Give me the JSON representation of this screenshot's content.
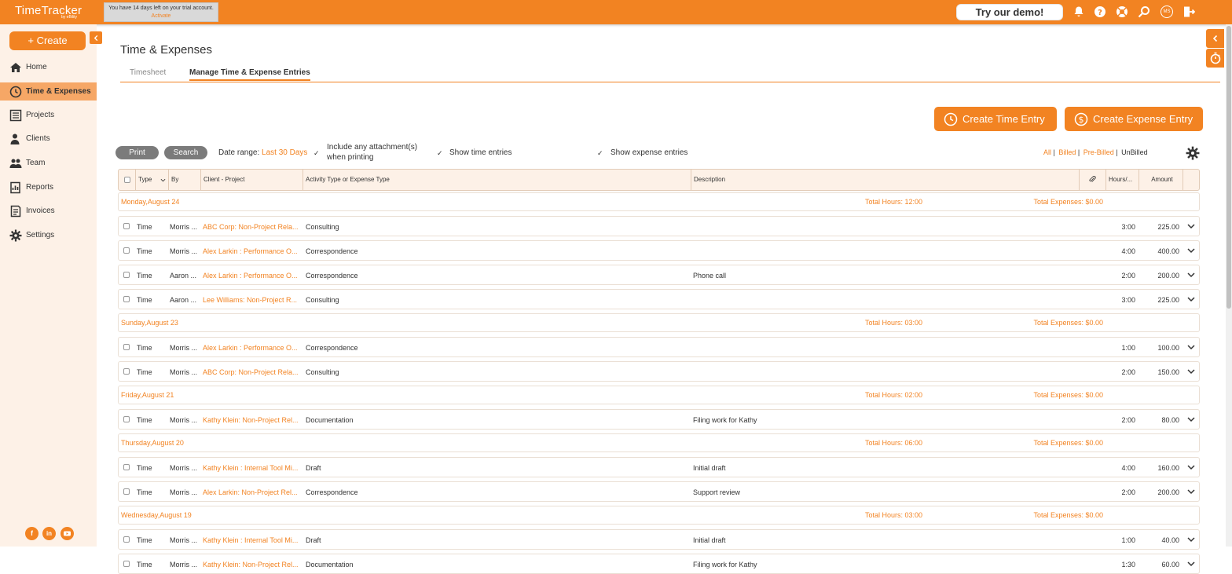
{
  "app": {
    "logo": "TimeTracker",
    "logo_sub": "by eBility",
    "trial_text": "You have 14 days left on your trial account.",
    "trial_link": "Activate",
    "demo_button": "Try our demo!",
    "avatar_initials": "MS"
  },
  "sidebar": {
    "create_label": "+ Create",
    "items": [
      {
        "label": "Home",
        "icon": "home-icon"
      },
      {
        "label": "Time & Expenses",
        "icon": "clock-icon",
        "active": true
      },
      {
        "label": "Projects",
        "icon": "projects-icon"
      },
      {
        "label": "Clients",
        "icon": "clients-icon"
      },
      {
        "label": "Team",
        "icon": "team-icon"
      },
      {
        "label": "Reports",
        "icon": "reports-icon"
      },
      {
        "label": "Invoices",
        "icon": "invoices-icon"
      },
      {
        "label": "Settings",
        "icon": "settings-icon"
      }
    ],
    "social": [
      "f",
      "in",
      "yt"
    ]
  },
  "main": {
    "title": "Time & Expenses",
    "tabs": [
      {
        "label": "Timesheet",
        "active": false
      },
      {
        "label": "Manage Time & Expense Entries",
        "active": true
      }
    ],
    "create_time_label": "Create Time Entry",
    "create_expense_label": "Create Expense Entry"
  },
  "filters": {
    "print": "Print",
    "search": "Search",
    "date_range_label": "Date range:",
    "date_range_value": "Last 30 Days",
    "include_attachments_line1": "Include any attachment(s)",
    "include_attachments_line2": "when printing",
    "show_time": "Show time entries",
    "show_expense": "Show expense entries",
    "billing": [
      "All",
      "Billed",
      "Pre-Billed",
      "UnBilled"
    ],
    "sep": "|"
  },
  "table": {
    "headers": {
      "type": "Type",
      "by": "By",
      "client_project": "Client - Project",
      "activity": "Activity Type or Expense Type",
      "description": "Description",
      "hours": "Hours/...",
      "amount": "Amount"
    },
    "groups": [
      {
        "date": "Monday,August 24",
        "hours": "Total Hours: 12:00",
        "expenses": "Total Expenses: $0.00",
        "rows": [
          {
            "type": "Time",
            "by": "Morris ...",
            "project": "ABC Corp: Non-Project Rela...",
            "activity": "Consulting",
            "desc": "",
            "hours": "3:00",
            "amount": "225.00"
          },
          {
            "type": "Time",
            "by": "Morris ...",
            "project": "Alex Larkin : Performance O...",
            "activity": "Correspondence",
            "desc": "",
            "hours": "4:00",
            "amount": "400.00"
          },
          {
            "type": "Time",
            "by": "Aaron ...",
            "project": "Alex Larkin : Performance O...",
            "activity": "Correspondence",
            "desc": "Phone call",
            "hours": "2:00",
            "amount": "200.00"
          },
          {
            "type": "Time",
            "by": "Aaron ...",
            "project": "Lee Williams: Non-Project R...",
            "activity": "Consulting",
            "desc": "",
            "hours": "3:00",
            "amount": "225.00"
          }
        ]
      },
      {
        "date": "Sunday,August 23",
        "hours": "Total Hours: 03:00",
        "expenses": "Total Expenses: $0.00",
        "rows": [
          {
            "type": "Time",
            "by": "Morris ...",
            "project": "Alex Larkin : Performance O...",
            "activity": "Correspondence",
            "desc": "",
            "hours": "1:00",
            "amount": "100.00"
          },
          {
            "type": "Time",
            "by": "Morris ...",
            "project": "ABC Corp: Non-Project Rela...",
            "activity": "Consulting",
            "desc": "",
            "hours": "2:00",
            "amount": "150.00"
          }
        ]
      },
      {
        "date": "Friday,August 21",
        "hours": "Total Hours: 02:00",
        "expenses": "Total Expenses: $0.00",
        "rows": [
          {
            "type": "Time",
            "by": "Morris ...",
            "project": "Kathy Klein: Non-Project Rel...",
            "activity": "Documentation",
            "desc": "Filing work for Kathy",
            "hours": "2:00",
            "amount": "80.00"
          }
        ]
      },
      {
        "date": "Thursday,August 20",
        "hours": "Total Hours: 06:00",
        "expenses": "Total Expenses: $0.00",
        "rows": [
          {
            "type": "Time",
            "by": "Morris ...",
            "project": "Kathy Klein : Internal Tool Mi...",
            "activity": "Draft",
            "desc": "Initial draft",
            "hours": "4:00",
            "amount": "160.00"
          },
          {
            "type": "Time",
            "by": "Morris ...",
            "project": "Alex Larkin: Non-Project Rel...",
            "activity": "Correspondence",
            "desc": "Support review",
            "hours": "2:00",
            "amount": "200.00"
          }
        ]
      },
      {
        "date": "Wednesday,August 19",
        "hours": "Total Hours: 03:00",
        "expenses": "Total Expenses: $0.00",
        "rows": [
          {
            "type": "Time",
            "by": "Morris ...",
            "project": "Kathy Klein : Internal Tool Mi...",
            "activity": "Draft",
            "desc": "Initial draft",
            "hours": "1:00",
            "amount": "40.00"
          },
          {
            "type": "Time",
            "by": "Morris ...",
            "project": "Kathy Klein: Non-Project Rel...",
            "activity": "Documentation",
            "desc": "Filing work for Kathy",
            "hours": "1:30",
            "amount": "60.00"
          }
        ]
      }
    ]
  },
  "colors": {
    "accent": "#f28322",
    "sidebar_bg": "#fdf1e7",
    "active_nav": "#f6a766"
  }
}
